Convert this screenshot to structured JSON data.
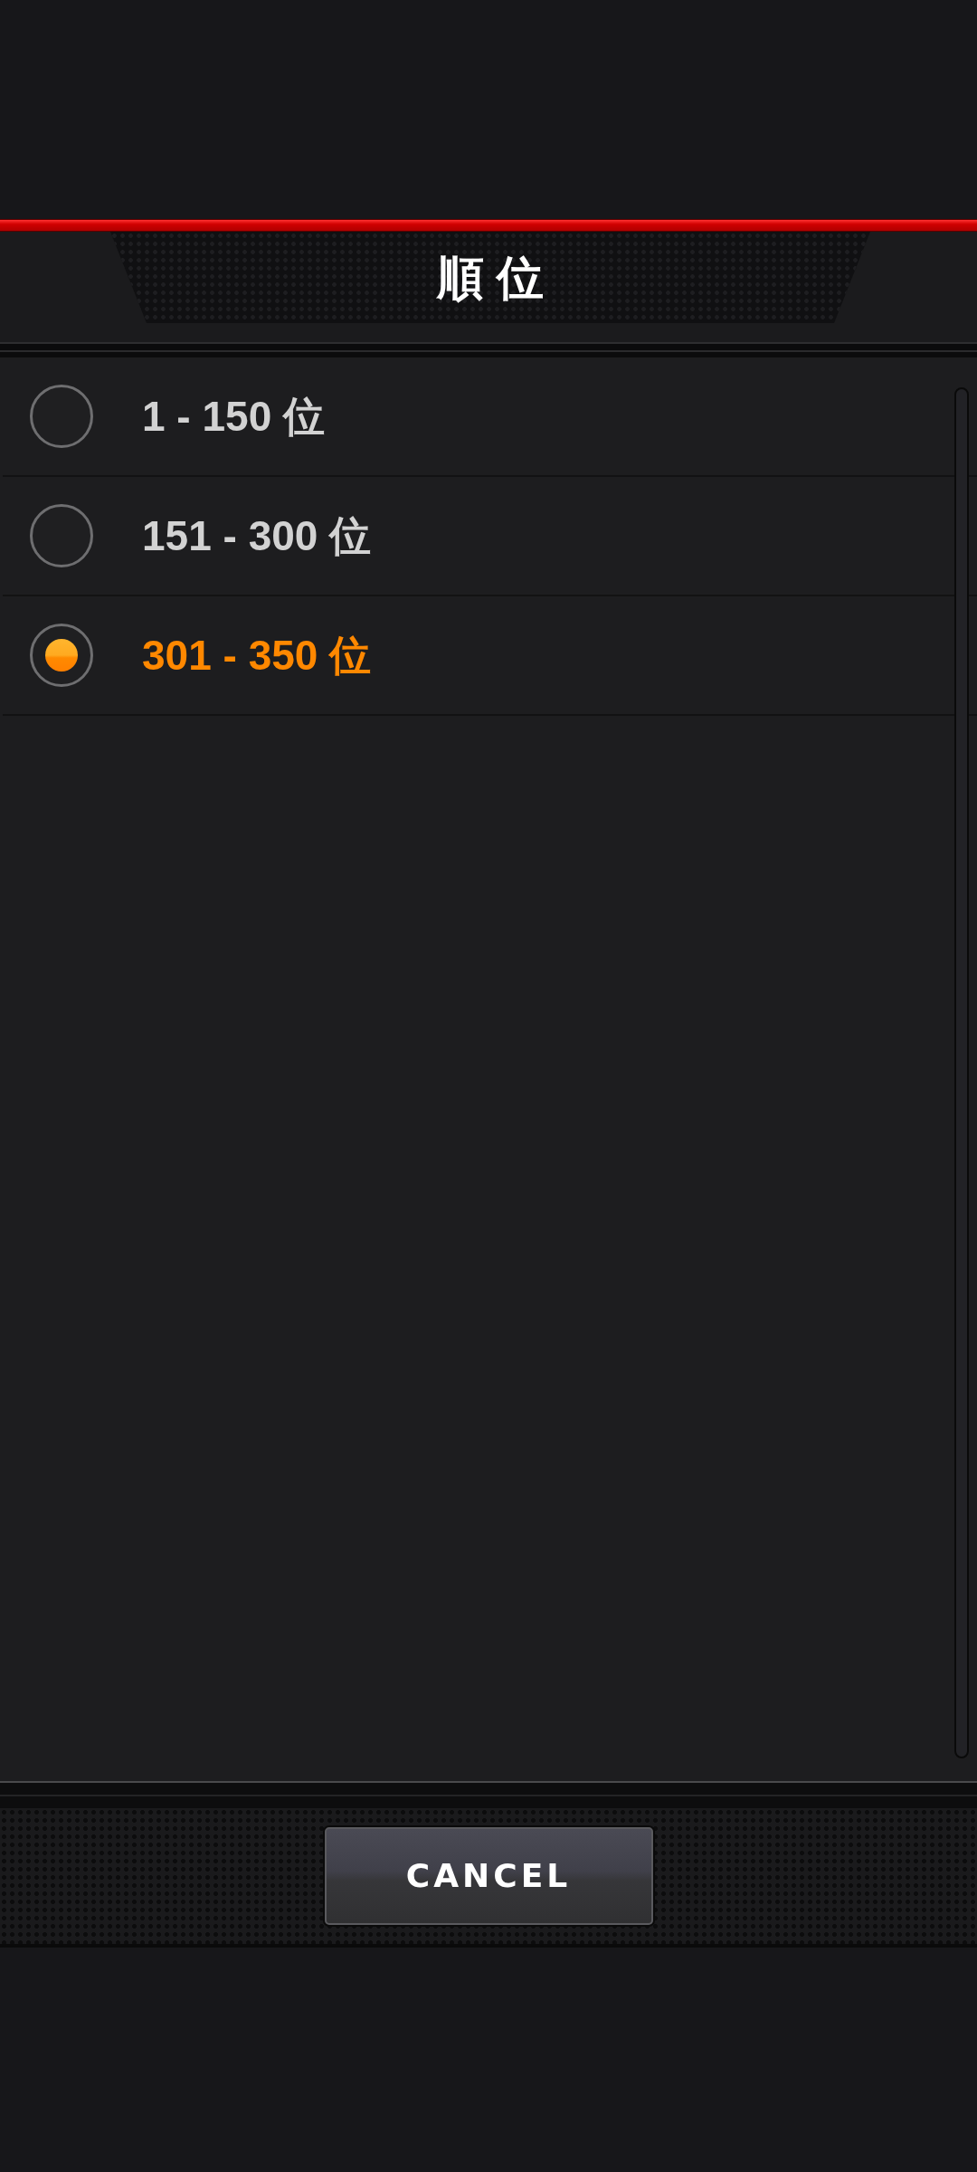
{
  "header": {
    "title": "順 位"
  },
  "options": [
    {
      "label": "1 - 150 位",
      "selected": false
    },
    {
      "label": "151 - 300 位",
      "selected": false
    },
    {
      "label": "301 - 350 位",
      "selected": true
    }
  ],
  "footer": {
    "buttons": [
      {
        "label": "CANCEL"
      }
    ]
  }
}
